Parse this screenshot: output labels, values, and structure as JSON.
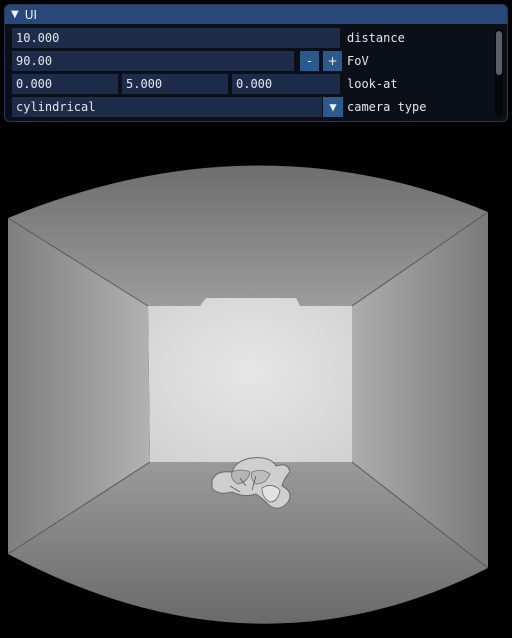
{
  "window": {
    "title": "UI",
    "collapse_icon": "triangle-down-icon"
  },
  "controls": {
    "distance": {
      "value": "10.000",
      "label": "distance"
    },
    "fov": {
      "value": "90.00",
      "label": "FoV",
      "minus": "-",
      "plus": "+"
    },
    "look_at": {
      "x": "0.000",
      "y": "5.000",
      "z": "0.000",
      "label": "look-at"
    },
    "camera_type": {
      "value": "cylindrical",
      "label": "camera type",
      "arrow": "▼"
    }
  },
  "colors": {
    "titlebar": "#29487a",
    "field_bg": "#1d2d49",
    "button": "#2a5a8e",
    "window_bg": "#0b0f18"
  }
}
